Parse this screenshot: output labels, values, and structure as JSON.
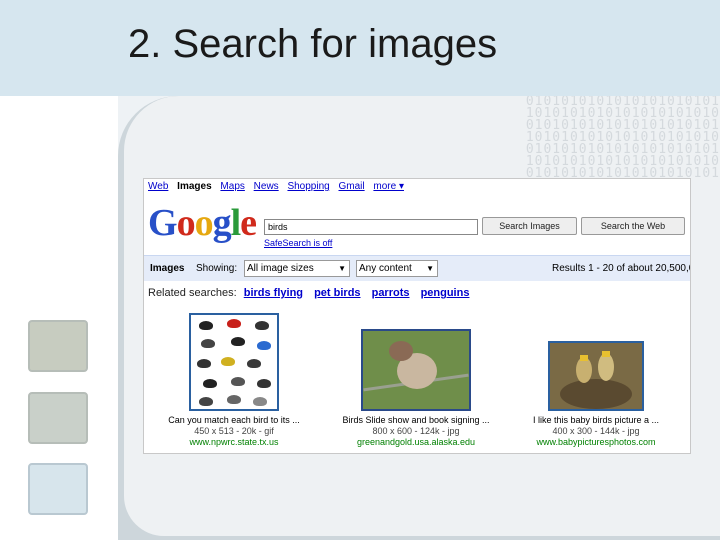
{
  "slide": {
    "title": "2. Search for images",
    "binary_pattern": "0101010101010101010101 1010101010101010101010 0101010101010101010101 1010101010101010101010 0101010101010101010101 1010101010101010101010 0101010101010101010101"
  },
  "google": {
    "nav": [
      "Web",
      "Images",
      "Maps",
      "News",
      "Shopping",
      "Gmail",
      "more ▾"
    ],
    "active_nav": "Images",
    "logo": "Google",
    "search_value": "birds",
    "search_images_button": "Search Images",
    "search_web_button": "Search the Web",
    "safesearch": "SafeSearch is off"
  },
  "toolbar": {
    "images_label": "Images",
    "showing_label": "Showing:",
    "size_select": "All image sizes",
    "content_select": "Any content",
    "results_text": "Results 1 - 20 of about 20,500,0"
  },
  "related": {
    "label": "Related searches:",
    "links": [
      "birds flying",
      "pet birds",
      "parrots",
      "penguins"
    ]
  },
  "results": [
    {
      "caption": "Can you match each bird to its ...",
      "meta": "450 x 513 - 20k - gif",
      "url": "www.npwrc.state.tx.us"
    },
    {
      "caption": "Birds Slide show and book signing ...",
      "meta": "800 x 600 - 124k - jpg",
      "url": "greenandgold.usa.alaska.edu"
    },
    {
      "caption": "I like this baby birds picture a ...",
      "meta": "400 x 300 - 144k - jpg",
      "url": "www.babypicturesphotos.com"
    }
  ],
  "colors": {
    "link": "#0000cc",
    "url_green": "#008000",
    "toolbar_bg": "#e5ecf9",
    "title_bar": "#d6e6ef"
  }
}
